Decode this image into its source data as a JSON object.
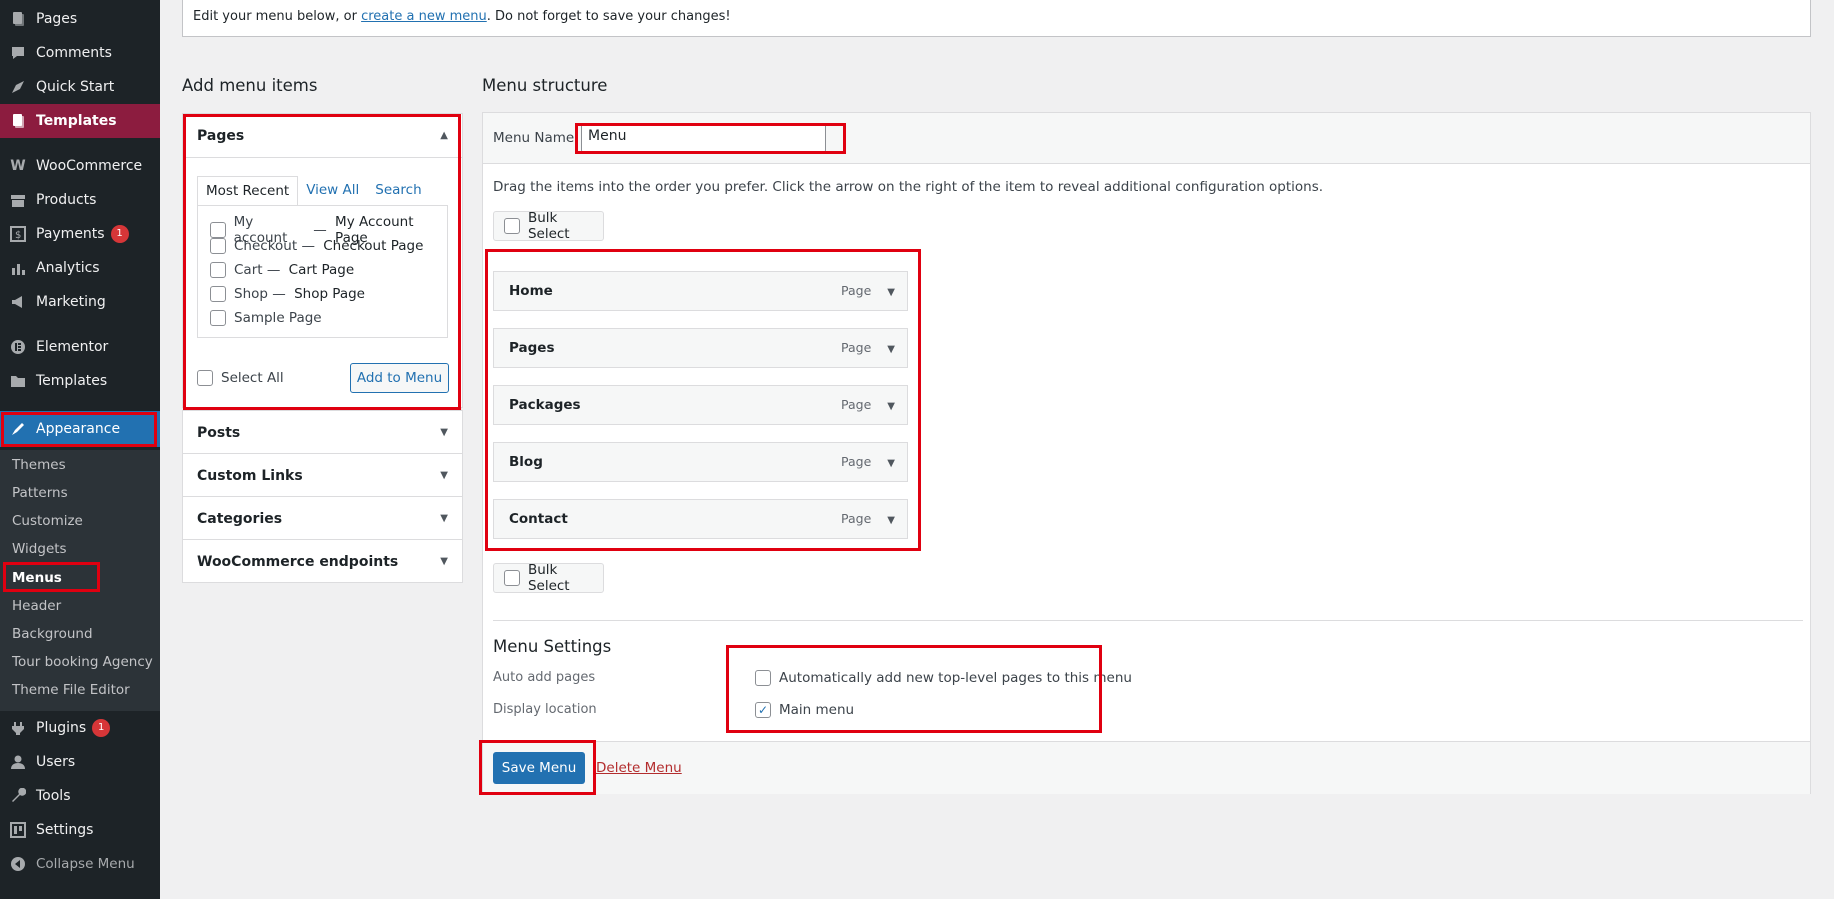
{
  "sidebar": {
    "items": [
      {
        "label": "Pages",
        "icon": "pages-icon"
      },
      {
        "label": "Comments",
        "icon": "comments-icon"
      },
      {
        "label": "Quick Start",
        "icon": "quick-start-icon"
      },
      {
        "label": "Templates",
        "icon": "templates-icon"
      },
      {
        "label": "WooCommerce",
        "icon": "woocommerce-icon"
      },
      {
        "label": "Products",
        "icon": "products-icon"
      },
      {
        "label": "Payments",
        "icon": "payments-icon",
        "badge": "1"
      },
      {
        "label": "Analytics",
        "icon": "analytics-icon"
      },
      {
        "label": "Marketing",
        "icon": "marketing-icon"
      },
      {
        "label": "Elementor",
        "icon": "elementor-icon"
      },
      {
        "label": "Templates",
        "icon": "folder-icon"
      },
      {
        "label": "Appearance",
        "icon": "appearance-icon"
      },
      {
        "label": "Plugins",
        "icon": "plugins-icon",
        "badge": "1"
      },
      {
        "label": "Users",
        "icon": "users-icon"
      },
      {
        "label": "Tools",
        "icon": "tools-icon"
      },
      {
        "label": "Settings",
        "icon": "settings-icon"
      }
    ],
    "submenu": [
      "Themes",
      "Patterns",
      "Customize",
      "Widgets",
      "Menus",
      "Header",
      "Background",
      "Tour booking Agency",
      "Theme File Editor"
    ],
    "collapse_label": "Collapse Menu"
  },
  "notice": {
    "before": "Edit your menu below, or ",
    "link": "create a new menu",
    "after": ". Do not forget to save your changes!"
  },
  "add_items": {
    "heading": "Add menu items",
    "pages": {
      "title": "Pages",
      "tabs": [
        "Most Recent",
        "View All",
        "Search"
      ],
      "rows": [
        {
          "name": "My account",
          "sep": " — ",
          "bold": "My Account Page"
        },
        {
          "name": "Checkout",
          "sep": " — ",
          "bold": "Checkout Page"
        },
        {
          "name": "Cart",
          "sep": " — ",
          "bold": "Cart Page"
        },
        {
          "name": "Shop",
          "sep": " — ",
          "bold": "Shop Page"
        },
        {
          "name": "Sample Page",
          "sep": "",
          "bold": ""
        }
      ],
      "select_all": "Select All",
      "add_button": "Add to Menu"
    },
    "other_sections": [
      "Posts",
      "Custom Links",
      "Categories",
      "WooCommerce endpoints"
    ]
  },
  "structure": {
    "heading": "Menu structure",
    "name_label": "Menu Name",
    "name_value": "Menu",
    "instructions": "Drag the items into the order you prefer. Click the arrow on the right of the item to reveal additional configuration options.",
    "bulk_select": "Bulk Select",
    "items": [
      {
        "title": "Home",
        "type": "Page"
      },
      {
        "title": "Pages",
        "type": "Page"
      },
      {
        "title": "Packages",
        "type": "Page"
      },
      {
        "title": "Blog",
        "type": "Page"
      },
      {
        "title": "Contact",
        "type": "Page"
      }
    ],
    "settings": {
      "heading": "Menu Settings",
      "auto_add_label": "Auto add pages",
      "auto_add_text": "Automatically add new top-level pages to this menu",
      "auto_add_checked": false,
      "display_label": "Display location",
      "location_text": "Main menu",
      "location_checked": true
    },
    "save_button": "Save Menu",
    "delete_link": "Delete Menu"
  }
}
